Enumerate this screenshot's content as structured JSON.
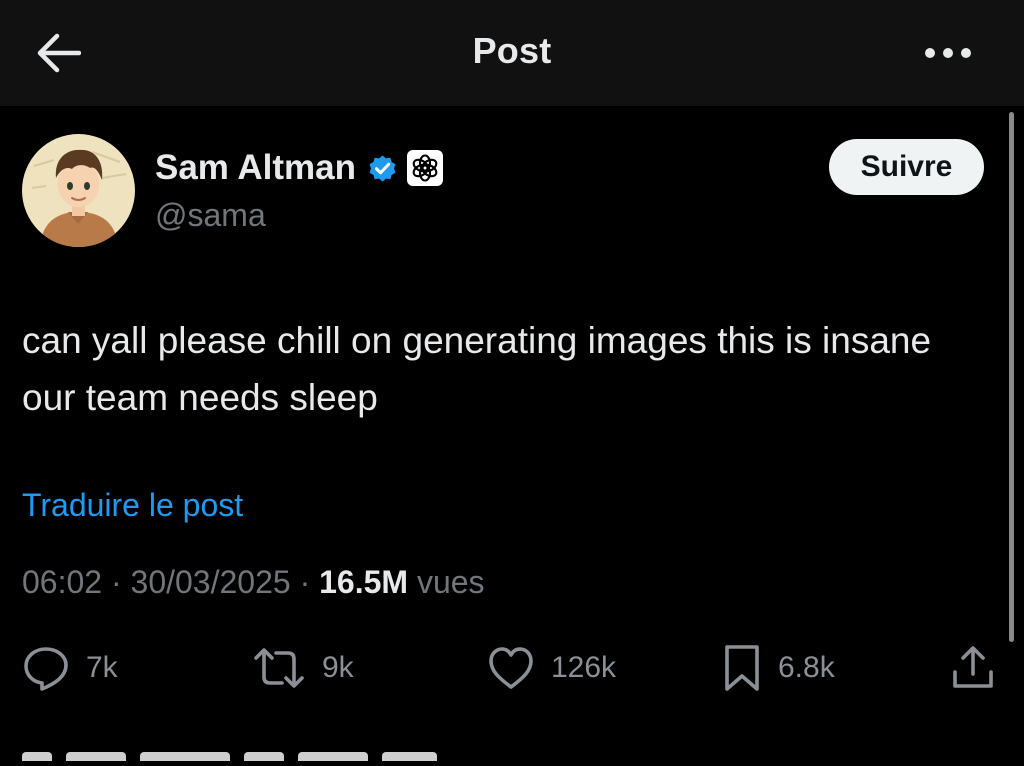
{
  "header": {
    "title": "Post",
    "back_icon": "arrow-left-icon",
    "more_icon": "more-horizontal-icon"
  },
  "post": {
    "author": {
      "name": "Sam Altman",
      "handle": "@sama",
      "verified_icon": "verified-badge-icon",
      "affiliation_icon": "openai-logo-icon"
    },
    "follow_label": "Suivre",
    "text": "can yall please chill on generating images this is insane our team needs sleep",
    "translate_label": "Traduire le post",
    "time": "06:02",
    "date": "30/03/2025",
    "separator": "·",
    "views_count": "16.5M",
    "views_label": "vues"
  },
  "actions": {
    "replies": "7k",
    "reposts": "9k",
    "likes": "126k",
    "bookmarks": "6.8k"
  },
  "colors": {
    "background": "#000000",
    "header_background": "#111111",
    "text_primary": "#e7e9ea",
    "text_secondary": "#71767b",
    "link": "#1d9bf0",
    "verified": "#1d9bf0",
    "button_bg": "#eff3f4"
  }
}
